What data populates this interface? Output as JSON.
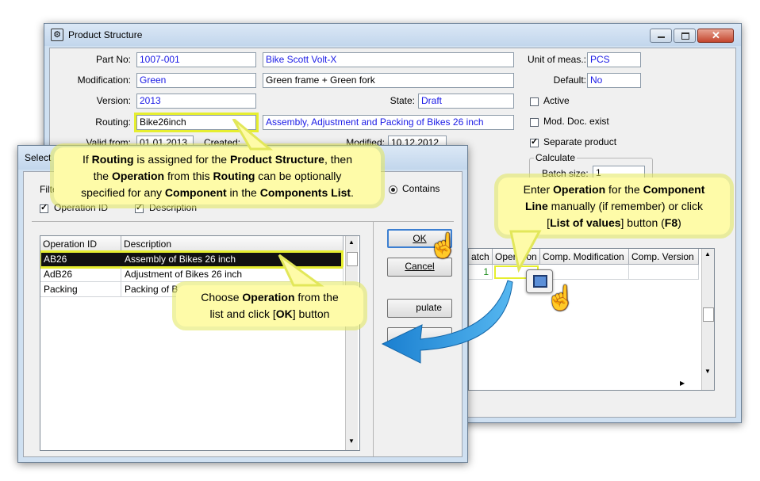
{
  "main_window": {
    "title": "Product Structure",
    "labels": {
      "part_no": "Part No:",
      "modification": "Modification:",
      "version": "Version:",
      "routing": "Routing:",
      "valid_from": "Valid from:",
      "created": "Created:",
      "modified": "Modified:",
      "state": "State:",
      "unit": "Unit of meas.:",
      "default": "Default:"
    },
    "values": {
      "part_no": "1007-001",
      "part_desc": "Bike Scott Volt-X",
      "modification": "Green",
      "modification_desc": "Green frame + Green fork",
      "version": "2013",
      "state": "Draft",
      "routing": "Bike26inch",
      "routing_desc": "Assembly, Adjustment and Packing of Bikes 26 inch",
      "valid_from": "01.01.2013",
      "modified": "10.12.2012",
      "unit": "PCS",
      "default": "No"
    },
    "checkboxes": {
      "active": {
        "label": "Active",
        "checked": false
      },
      "mod_doc": {
        "label": "Mod. Doc. exist",
        "checked": false
      },
      "separate": {
        "label": "Separate product",
        "checked": true
      }
    },
    "calculate": {
      "group_label": "Calculate",
      "batch_label": "Batch size:",
      "batch_value": "1"
    },
    "components_grid": {
      "columns": [
        "atch",
        "Operation",
        "Comp. Modification",
        "Comp. Version"
      ],
      "row": {
        "batch": "1",
        "operation": "",
        "comp_modification": "",
        "comp_version": ""
      }
    }
  },
  "select_dialog": {
    "title": "Select",
    "filter_label": "Filte",
    "contains_label": "Contains",
    "check_operation_id": "Operation ID",
    "check_description": "Description",
    "ok": "OK",
    "cancel": "Cancel",
    "populate": "pulate",
    "list_columns": [
      "Operation ID",
      "Description"
    ],
    "rows": [
      {
        "id": "AB26",
        "desc": "Assembly of Bikes 26 inch"
      },
      {
        "id": "AdB26",
        "desc": "Adjustment of Bikes 26 inch"
      },
      {
        "id": "Packing",
        "desc": "Packing of B"
      }
    ]
  },
  "callouts": {
    "routing": {
      "l1a": "If ",
      "l1b": "Routing",
      "l1c": " is assigned for the ",
      "l1d": "Product Structure",
      "l1e": ", then",
      "l2a": "the ",
      "l2b": "Operation",
      "l2c": " from this ",
      "l2d": "Routing",
      "l2e": " can be optionally",
      "l3a": "specified for any ",
      "l3b": "Component",
      "l3c": " in the ",
      "l3d": "Components List",
      "l3e": "."
    },
    "operation": {
      "l1a": "Enter ",
      "l1b": "Operation",
      "l1c": " for the ",
      "l1d": "Component",
      "l2a": "Line",
      "l2b": " manually (if remember) or click",
      "l3a": "[",
      "l3b": "List of values",
      "l3c": "] button (",
      "l3d": "F8",
      "l3e": ")"
    },
    "choose": {
      "l1a": "Choose ",
      "l1b": "Operation",
      "l1c": " from the",
      "l2a": "list and click [",
      "l2b": "OK",
      "l2c": "] button"
    }
  },
  "colors": {
    "highlight": "#e6ee2f",
    "callout_bg": "#fefba8",
    "arrow": "#1f8fd8",
    "value_text": "#1a1ae6"
  }
}
